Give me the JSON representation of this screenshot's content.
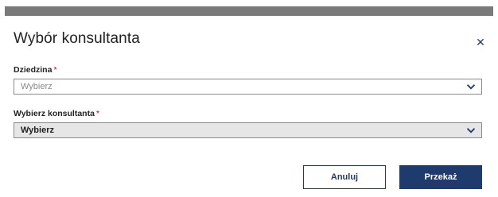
{
  "dialog": {
    "title": "Wybór konsultanta",
    "close_icon": "close-icon"
  },
  "fields": {
    "domain": {
      "label": "Dziedzina",
      "required_mark": "*",
      "value": "Wybierz"
    },
    "consultant": {
      "label": "Wybierz konsultanta",
      "required_mark": "*",
      "value": "Wybierz"
    }
  },
  "buttons": {
    "cancel_label": "Anuluj",
    "submit_label": "Przekaż"
  },
  "colors": {
    "accent": "#1f3b6e",
    "required": "#d0021b",
    "topbar": "#7a7a7a"
  }
}
